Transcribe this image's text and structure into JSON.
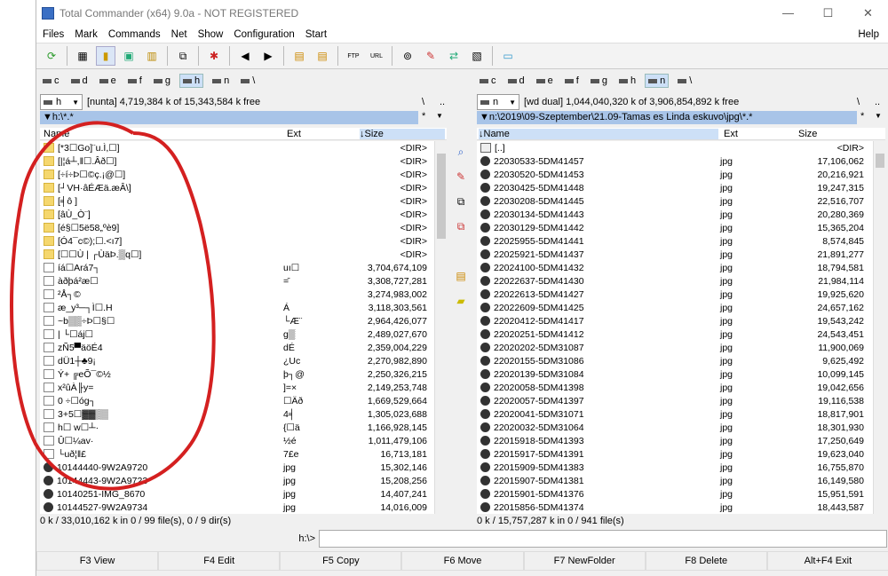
{
  "window": {
    "title": "Total Commander (x64) 9.0a - NOT REGISTERED",
    "min": "—",
    "max": "☐",
    "close": "✕"
  },
  "menu": [
    "Files",
    "Mark",
    "Commands",
    "Net",
    "Show",
    "Configuration",
    "Start"
  ],
  "help": "Help",
  "toolbar_icons": [
    "refresh-icon",
    "brief-view-icon",
    "tree-view-icon",
    "thumbnail-icon",
    "compare-icon",
    "branch-icon",
    "target-icon",
    "back-icon",
    "forward-icon",
    "pack-icon",
    "unpack-icon",
    "ftp-icon",
    "url-icon",
    "search-icon",
    "multi-rename-icon",
    "sync-dirs-icon",
    "copy-names-icon",
    "notepad-icon"
  ],
  "left": {
    "drives": [
      "c",
      "d",
      "e",
      "f",
      "g",
      "h",
      "n",
      "\\"
    ],
    "active_drive": "h",
    "drive_select": "h",
    "free": "[nunta]  4,719,384 k of 15,343,584 k free",
    "path": "h:\\*.*",
    "root": "\\",
    "dotdot": "..",
    "star": "*",
    "arrow": "▼",
    "headers": {
      "name": "Name",
      "ext": "Ext",
      "size": "↓Size"
    },
    "rows": [
      [
        "folder",
        "[*3☐Go]¨u.Ì,☐]",
        "",
        "<DIR>"
      ],
      [
        "folder",
        "[|¦á┴,‖☐.Âð☐]",
        "",
        "<DIR>"
      ],
      [
        "folder",
        "[÷í÷Þ☐©ç.¡@☐]",
        "",
        "<DIR>"
      ],
      [
        "folder",
        "[┘VH·âÉÆä.æÂ\\]",
        "",
        "<DIR>"
      ],
      [
        "folder",
        "[╡ô ]",
        "",
        "<DIR>"
      ],
      [
        "folder",
        "[âÙ_Ò¨]",
        "",
        "<DIR>"
      ],
      [
        "folder",
        "[é§☐5ë58„ºè9]",
        "",
        "<DIR>"
      ],
      [
        "folder",
        "[Ó4¯c©);☐.<ı7]",
        "",
        "<DIR>"
      ],
      [
        "folder",
        "[☐☐Ù | ┌ÙäÞ.▒q☐]",
        "",
        "<DIR>"
      ],
      [
        "file",
        "íá☐Ará7┐",
        "uı☐",
        "3,704,674,109"
      ],
      [
        "file",
        "àðþá²æ☐",
        "=̄",
        "3,308,727,281"
      ],
      [
        "file",
        "²Å┐©",
        "",
        "3,274,983,002"
      ],
      [
        "file",
        "æ_y³─┐Ì☐.H",
        "Á",
        "3,118,303,561"
      ],
      [
        "file",
        "~b▒▒÷Þ☐§☐",
        "└Æ¨",
        "2,964,426,077"
      ],
      [
        "file",
        "| └☐áj☐",
        "g▒",
        "2,489,027,670"
      ],
      [
        "file",
        "zÑ5▀äöÉ4",
        "dÉ",
        "2,359,004,229"
      ],
      [
        "file",
        "dÜ1┼♣9¡",
        "¿Uc",
        "2,270,982,890"
      ],
      [
        "file",
        "Ý+ ╔eÕ¯©½",
        "þ┐@",
        "2,250,326,215"
      ],
      [
        "file",
        "x²ûÀ╟y=",
        "]=×",
        "2,149,253,748"
      ],
      [
        "file",
        "0 ÷☐óg┐",
        "☐Äð",
        "1,669,529,664"
      ],
      [
        "file",
        "3+5☐▓▓▒▒",
        "4╡",
        "1,305,023,688"
      ],
      [
        "file",
        "h☐ w☐┴·",
        "{☐ä",
        "1,166,928,145"
      ],
      [
        "file",
        "Û☐¼av·",
        "½é",
        "1,011,479,106"
      ],
      [
        "file",
        "└uð¦‖£",
        "7£e",
        "16,713,181"
      ],
      [
        "gear",
        "10144440-9W2A9720",
        "jpg",
        "15,302,146"
      ],
      [
        "gear",
        "10144443-9W2A9723",
        "jpg",
        "15,208,256"
      ],
      [
        "gear",
        "10140251-IMG_8670",
        "jpg",
        "14,407,241"
      ],
      [
        "gear",
        "10144527-9W2A9734",
        "jpg",
        "14,016,009"
      ]
    ],
    "status": "0 k / 33,010,162 k in 0 / 99 file(s), 0 / 9 dir(s)"
  },
  "right": {
    "drives": [
      "c",
      "d",
      "e",
      "f",
      "g",
      "h",
      "n",
      "\\"
    ],
    "active_drive": "n",
    "drive_select": "n",
    "free": "[wd dual]  1,044,040,320 k of 3,906,854,892 k free",
    "path": "n:\\2019\\09-Szeptember\\21.09-Tamas es Linda eskuvo\\jpg\\*.*",
    "root": "\\",
    "dotdot": "..",
    "star": "*",
    "arrow": "▼",
    "headers": {
      "name": "↓Name",
      "ext": "Ext",
      "size": "Size"
    },
    "rows": [
      [
        "up",
        "[..]",
        "",
        "<DIR>"
      ],
      [
        "gear",
        "22030533-5DM41457",
        "jpg",
        "17,106,062"
      ],
      [
        "gear",
        "22030520-5DM41453",
        "jpg",
        "20,216,921"
      ],
      [
        "gear",
        "22030425-5DM41448",
        "jpg",
        "19,247,315"
      ],
      [
        "gear",
        "22030208-5DM41445",
        "jpg",
        "22,516,707"
      ],
      [
        "gear",
        "22030134-5DM41443",
        "jpg",
        "20,280,369"
      ],
      [
        "gear",
        "22030129-5DM41442",
        "jpg",
        "15,365,204"
      ],
      [
        "gear",
        "22025955-5DM41441",
        "jpg",
        "8,574,845"
      ],
      [
        "gear",
        "22025921-5DM41437",
        "jpg",
        "21,891,277"
      ],
      [
        "gear",
        "22024100-5DM41432",
        "jpg",
        "18,794,581"
      ],
      [
        "gear",
        "22022637-5DM41430",
        "jpg",
        "21,984,114"
      ],
      [
        "gear",
        "22022613-5DM41427",
        "jpg",
        "19,925,620"
      ],
      [
        "gear",
        "22022609-5DM41425",
        "jpg",
        "24,657,162"
      ],
      [
        "gear",
        "22020412-5DM41417",
        "jpg",
        "19,543,242"
      ],
      [
        "gear",
        "22020251-5DM41412",
        "jpg",
        "24,543,451"
      ],
      [
        "gear",
        "22020202-5DM31087",
        "jpg",
        "11,900,069"
      ],
      [
        "gear",
        "22020155-5DM31086",
        "jpg",
        "9,625,492"
      ],
      [
        "gear",
        "22020139-5DM31084",
        "jpg",
        "10,099,145"
      ],
      [
        "gear",
        "22020058-5DM41398",
        "jpg",
        "19,042,656"
      ],
      [
        "gear",
        "22020057-5DM41397",
        "jpg",
        "19,116,538"
      ],
      [
        "gear",
        "22020041-5DM31071",
        "jpg",
        "18,817,901"
      ],
      [
        "gear",
        "22020032-5DM31064",
        "jpg",
        "18,301,930"
      ],
      [
        "gear",
        "22015918-5DM41393",
        "jpg",
        "17,250,649"
      ],
      [
        "gear",
        "22015917-5DM41391",
        "jpg",
        "19,623,040"
      ],
      [
        "gear",
        "22015909-5DM41383",
        "jpg",
        "16,755,870"
      ],
      [
        "gear",
        "22015907-5DM41381",
        "jpg",
        "16,149,580"
      ],
      [
        "gear",
        "22015901-5DM41376",
        "jpg",
        "15,951,591"
      ],
      [
        "gear",
        "22015856-5DM41374",
        "jpg",
        "18,443,587"
      ]
    ],
    "status": "0 k / 15,757,287 k in 0 / 941 file(s)"
  },
  "cmdline": {
    "label": "h:\\>",
    "value": ""
  },
  "fkeys": [
    "F3 View",
    "F4 Edit",
    "F5 Copy",
    "F6 Move",
    "F7 NewFolder",
    "F8 Delete",
    "Alt+F4 Exit"
  ],
  "annotation": {
    "color": "#d42020"
  }
}
